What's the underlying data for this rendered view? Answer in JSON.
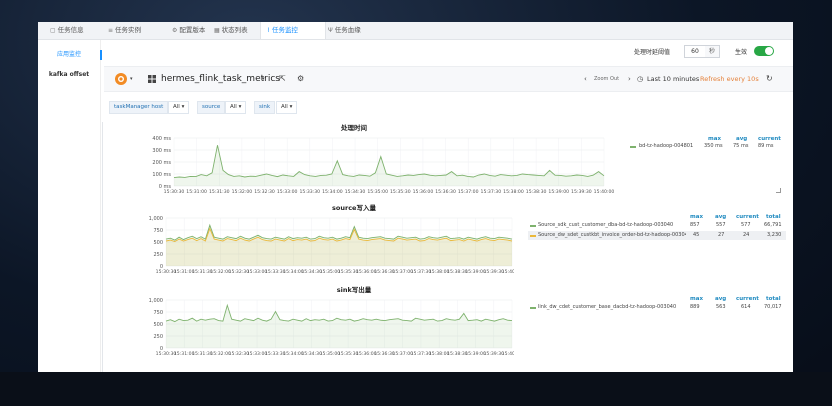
{
  "tabs": [
    {
      "icon": "file-icon",
      "label": "任务信息"
    },
    {
      "icon": "list-icon",
      "label": "任务实例"
    },
    {
      "icon": "settings-icon",
      "label": "配置版本"
    },
    {
      "icon": "grid-icon",
      "label": "状态列表"
    },
    {
      "icon": "monitor-icon",
      "label": "任务监控",
      "active": true
    },
    {
      "icon": "fork-icon",
      "label": "任务血缘"
    }
  ],
  "sidebar": {
    "items": [
      {
        "label": "应用监控",
        "active": true
      },
      {
        "label": "kafka offset",
        "active": false
      }
    ]
  },
  "config": {
    "threshold_label": "处理时延阈值",
    "threshold_value": "60",
    "threshold_unit": "秒",
    "toggle_label": "生效",
    "toggle_on": true
  },
  "grafana": {
    "dashboard_title": "hermes_flink_task_metrics",
    "zoom_out": "Zoom Out",
    "time_range": "Last 10 minutes",
    "refresh": "Refresh every 10s"
  },
  "variables": [
    {
      "label": "taskManager host",
      "value": "All"
    },
    {
      "label": "source",
      "value": "All"
    },
    {
      "label": "sink",
      "value": "All"
    }
  ],
  "colors": {
    "accent": "#1890ff",
    "series_green": "#7eb26d",
    "series_yellow": "#eab839",
    "refresh": "#e5823b",
    "toggle": "#28a745"
  },
  "chart_data": [
    {
      "type": "line",
      "title": "处理时间",
      "ylabels": [
        "400 ms",
        "300 ms",
        "200 ms",
        "100 ms",
        "0 ms"
      ],
      "ylim": [
        0,
        400
      ],
      "xticks": [
        "15:30:30",
        "15:31:00",
        "15:31:30",
        "15:32:00",
        "15:32:30",
        "15:33:00",
        "15:33:30",
        "15:34:00",
        "15:34:30",
        "15:35:00",
        "15:35:30",
        "15:36:00",
        "15:36:30",
        "15:37:00",
        "15:37:30",
        "15:38:00",
        "15:38:30",
        "15:39:00",
        "15:39:30",
        "15:40:00"
      ],
      "legend_columns": [
        "max",
        "avg",
        "current"
      ],
      "series": [
        {
          "name": "bd-tz-hadoop-004801",
          "color": "#7eb26d",
          "max": "350 ms",
          "avg": "75 ms",
          "current": "89 ms",
          "values": [
            70,
            75,
            72,
            80,
            78,
            95,
            85,
            110,
            340,
            130,
            95,
            80,
            85,
            75,
            82,
            80,
            90,
            100,
            88,
            78,
            92,
            85,
            80,
            120,
            95,
            85,
            80,
            88,
            90,
            100,
            210,
            95,
            85,
            80,
            92,
            88,
            82,
            110,
            245,
            100,
            90,
            80,
            85,
            92,
            88,
            95,
            100,
            90,
            85,
            88,
            92,
            120,
            85,
            90,
            80,
            75,
            92,
            100,
            88,
            82,
            95,
            90,
            85,
            88,
            100,
            95,
            92,
            88,
            85,
            130,
            90,
            88,
            82,
            85,
            92,
            88,
            80,
            90,
            120,
            85
          ]
        }
      ]
    },
    {
      "type": "line",
      "title": "source写入量",
      "ylabels": [
        "1,000",
        "750",
        "500",
        "250",
        "0"
      ],
      "ylim": [
        0,
        1000
      ],
      "xticks": [
        "15:30:30",
        "15:31:00",
        "15:31:30",
        "15:32:00",
        "15:32:30",
        "15:33:00",
        "15:33:30",
        "15:34:00",
        "15:34:30",
        "15:35:00",
        "15:35:30",
        "15:36:00",
        "15:36:30",
        "15:37:00",
        "15:37:30",
        "15:38:00",
        "15:38:30",
        "15:39:00",
        "15:39:30",
        "15:40:00"
      ],
      "legend_columns": [
        "max",
        "avg",
        "current",
        "total"
      ],
      "series": [
        {
          "name": "Source_sdk_cust_customer_dba-bd-tz-hadoop-003040",
          "color": "#7eb26d",
          "max": "857",
          "avg": "557",
          "current": "577",
          "total": "66,791",
          "values": [
            560,
            580,
            540,
            600,
            550,
            590,
            620,
            570,
            610,
            560,
            850,
            600,
            580,
            560,
            610,
            590,
            570,
            620,
            580,
            560,
            600,
            640,
            590,
            570,
            560,
            600,
            580,
            560,
            610,
            570,
            590,
            580,
            600,
            560,
            570,
            620,
            590,
            580,
            600,
            560,
            580,
            610,
            590,
            820,
            600,
            580,
            570,
            590,
            600,
            610,
            580,
            570,
            560,
            620,
            600,
            580,
            590,
            600,
            560,
            570,
            610,
            590,
            580,
            600,
            620,
            570,
            580,
            590,
            560,
            600,
            580,
            560,
            590,
            610,
            580,
            570,
            600,
            590,
            580,
            560
          ]
        },
        {
          "name": "Source_dw_sdet_custkbt_invoice_order-bd-tz-hadoop-003040",
          "color": "#eab839",
          "max": "45",
          "avg": "27",
          "current": "24",
          "total": "3,230",
          "values": [
            520,
            540,
            510,
            560,
            520,
            550,
            580,
            530,
            570,
            520,
            780,
            560,
            540,
            520,
            570,
            550,
            530,
            580,
            540,
            520,
            560,
            600,
            550,
            530,
            520,
            560,
            540,
            520,
            570,
            530,
            550,
            540,
            560,
            520,
            530,
            580,
            550,
            540,
            560,
            520,
            540,
            570,
            550,
            760,
            560,
            540,
            530,
            550,
            560,
            570,
            540,
            530,
            520,
            580,
            560,
            540,
            550,
            560,
            520,
            530,
            570,
            550,
            540,
            560,
            580,
            530,
            540,
            550,
            520,
            560,
            540,
            520,
            550,
            570,
            540,
            530,
            560,
            550,
            540,
            520
          ]
        }
      ]
    },
    {
      "type": "line",
      "title": "sink写出量",
      "ylabels": [
        "1,000",
        "750",
        "500",
        "250",
        "0"
      ],
      "ylim": [
        0,
        1000
      ],
      "xticks": [
        "15:30:30",
        "15:31:00",
        "15:31:30",
        "15:32:00",
        "15:32:30",
        "15:33:00",
        "15:33:30",
        "15:34:00",
        "15:34:30",
        "15:35:00",
        "15:35:30",
        "15:36:00",
        "15:36:30",
        "15:37:00",
        "15:37:30",
        "15:38:00",
        "15:38:30",
        "15:39:00",
        "15:39:30",
        "15:40:00"
      ],
      "legend_columns": [
        "max",
        "avg",
        "current",
        "total"
      ],
      "series": [
        {
          "name": "link_dw_cdet_customer_base_dacbd-tz-hadoop-003040",
          "color": "#7eb26d",
          "max": "889",
          "avg": "563",
          "current": "614",
          "total": "70,017",
          "values": [
            560,
            590,
            550,
            600,
            570,
            580,
            620,
            560,
            600,
            580,
            600,
            610,
            570,
            560,
            890,
            600,
            580,
            560,
            610,
            590,
            570,
            620,
            580,
            560,
            600,
            760,
            590,
            570,
            560,
            600,
            580,
            560,
            610,
            570,
            590,
            580,
            600,
            560,
            570,
            620,
            590,
            580,
            600,
            560,
            580,
            610,
            590,
            580,
            600,
            580,
            570,
            590,
            600,
            610,
            580,
            570,
            560,
            620,
            600,
            580,
            590,
            600,
            560,
            570,
            610,
            590,
            580,
            600,
            720,
            570,
            580,
            590,
            560,
            600,
            580,
            560,
            590,
            610,
            580,
            570
          ]
        }
      ]
    }
  ]
}
